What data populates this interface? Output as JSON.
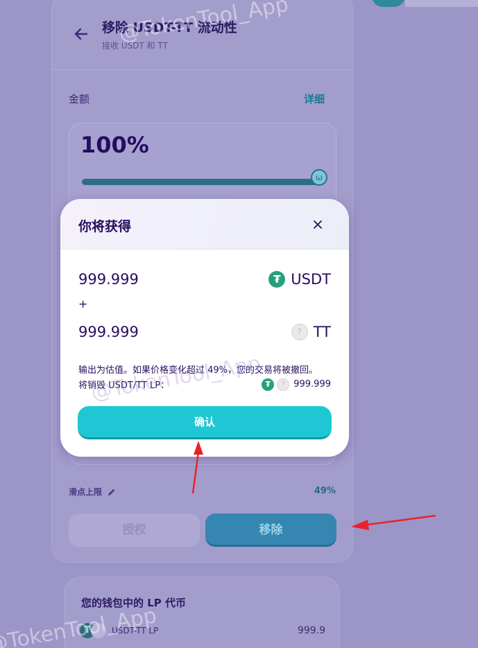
{
  "header": {
    "title": "移除 USDT-TT 流动性",
    "subtitle": "接收 USDT 和 TT"
  },
  "amount": {
    "label": "金额",
    "detail_link": "详细",
    "percent_text": "100%",
    "slider_value_percent": 100
  },
  "slippage": {
    "label": "滑点上限",
    "value": "49%"
  },
  "actions": {
    "approve_label": "授权",
    "remove_label": "移除"
  },
  "lp_card": {
    "title": "您的钱包中的 LP 代币",
    "pair": "USDT-TT LP",
    "amount": "999.9"
  },
  "modal": {
    "title": "你将获得",
    "receive": [
      {
        "amount": "999.999",
        "symbol": "USDT"
      },
      {
        "amount": "999.999",
        "symbol": "TT"
      }
    ],
    "plus": "+",
    "note": "输出为估值。如果价格变化超过 49%，您的交易将被撤回。",
    "burn_label": "将销毁 USDT/TT LP：",
    "burn_amount": "999.999",
    "confirm_label": "确认"
  },
  "watermark": "@TokenTool_App",
  "colors": {
    "accent": "#1fc7d4",
    "text_primary": "#280d5f",
    "usdt": "#26a17b",
    "annotation_arrow": "#e8222a"
  },
  "icons": {
    "back": "arrow-left-icon",
    "close": "close-icon",
    "edit": "pencil-icon",
    "usdt": "usdt-token-icon",
    "tt": "tt-token-icon"
  }
}
